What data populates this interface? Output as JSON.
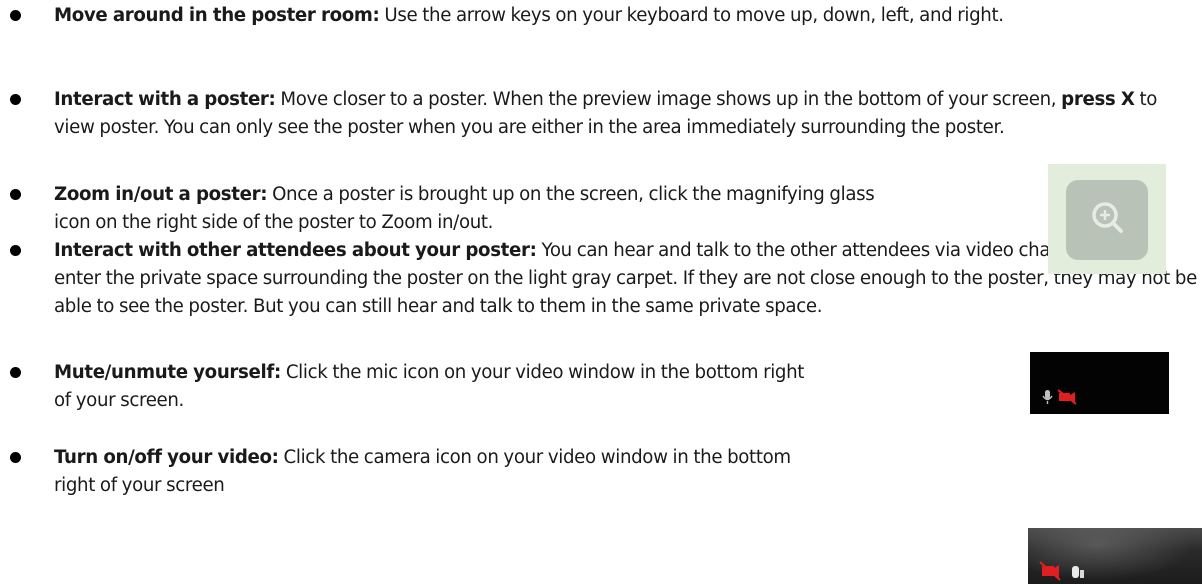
{
  "instructions": [
    {
      "id": "move",
      "lead": "Move around in the poster room:",
      "body": "Use the arrow keys on your keyboard to move up, down, left, and right."
    },
    {
      "id": "interact",
      "lead": "Interact with a poster:",
      "body_before": "Move closer to a poster. When the preview image shows up in the bottom of your screen,",
      "emphasis": "press X",
      "body_after": "to view poster. You can only see the poster when you are either in the area immediately surrounding the poster."
    },
    {
      "id": "zoom",
      "lead": "Zoom in/out a poster:",
      "body": "Once a poster is brought up on the screen, click the magnifying glass icon on the right side of the poster to Zoom in/out.",
      "thumbnail_icon": "magnifier-plus-icon"
    },
    {
      "id": "attendees",
      "lead": "Interact with other attendees about your poster:",
      "body": "You can hear and talk to the other attendees via video chat when they enter the private space surrounding the poster on the light gray carpet. If they are not close enough to the poster, they may not be able to see the poster. But you can still hear and talk to them in the same private space."
    },
    {
      "id": "mute",
      "lead": "Mute/unmute yourself:",
      "body": "Click the mic icon on your video window in the bottom right of your screen.",
      "thumbnail_icons": [
        "mic-icon",
        "camera-off-icon"
      ]
    },
    {
      "id": "video",
      "lead": "Turn on/off your video:",
      "body": "Click the camera icon on your video window in the bottom right of your screen",
      "thumbnail_icons": [
        "camera-off-icon",
        "mic-icon"
      ]
    }
  ],
  "colors": {
    "text": "#1a1a1a",
    "bullet": "#000000",
    "zoom_thumb_bg": "#e3eddc",
    "zoom_button": "#b9c2b6",
    "zoom_glyph": "#e6ece4",
    "video_window_bg": "#030303",
    "mic_glyph": "#bfbfbf",
    "camera_off_red": "#e02020"
  }
}
